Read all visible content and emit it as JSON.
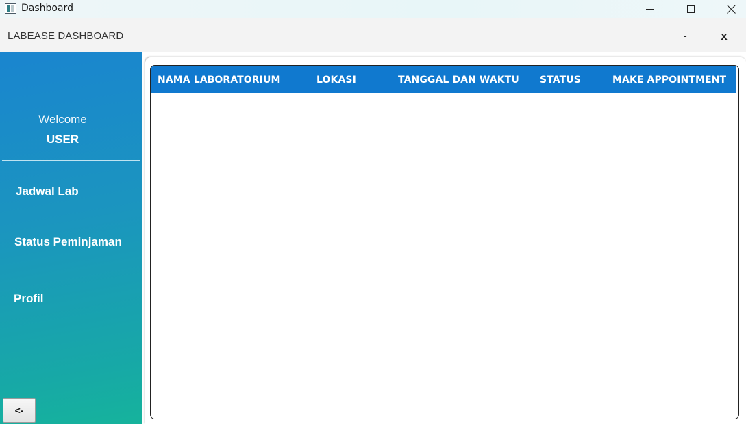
{
  "window": {
    "title": "Dashboard",
    "app_icon": "app-window-icon",
    "controls": {
      "minimize_icon": "minimize-icon",
      "maximize_icon": "maximize-icon",
      "close_icon": "close-icon"
    }
  },
  "header": {
    "title": "LABEASE DASHBOARD",
    "minimize_label": "-",
    "close_label": "x"
  },
  "sidebar": {
    "welcome": "Welcome",
    "user": "USER",
    "items": [
      {
        "label": "Jadwal Lab"
      },
      {
        "label": "Status Peminjaman"
      },
      {
        "label": "Profil"
      }
    ],
    "back_label": "<-",
    "colors": {
      "top": "#1a85cf",
      "bottom": "#16b39c"
    }
  },
  "table": {
    "columns": [
      "NAMA LABORATORIUM",
      "LOKASI",
      "TANGGAL DAN WAKTU",
      "STATUS",
      "MAKE APPOINTMENT"
    ],
    "rows": [],
    "header_color": "#1079cf"
  }
}
